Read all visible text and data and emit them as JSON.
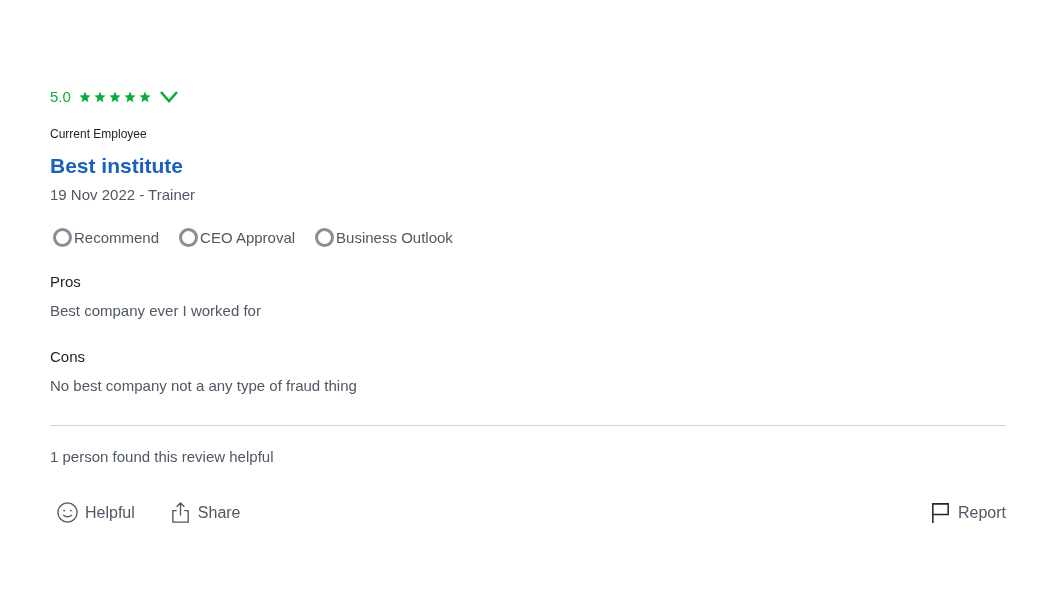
{
  "review": {
    "rating": "5.0",
    "stars": 5,
    "status": "Current Employee",
    "title": "Best institute",
    "date_role": "19 Nov 2022 - Trainer",
    "indicators": [
      {
        "label": "Recommend"
      },
      {
        "label": "CEO Approval"
      },
      {
        "label": "Business Outlook"
      }
    ],
    "sections": [
      {
        "heading": "Pros",
        "text": "Best company ever I worked for"
      },
      {
        "heading": "Cons",
        "text": "No best company not a any type of fraud thing"
      }
    ],
    "helpful_count": "1 person found this review helpful",
    "actions": [
      {
        "kind": "helpful",
        "label": "Helpful"
      },
      {
        "kind": "share",
        "label": "Share"
      },
      {
        "kind": "report",
        "label": "Report"
      }
    ]
  }
}
